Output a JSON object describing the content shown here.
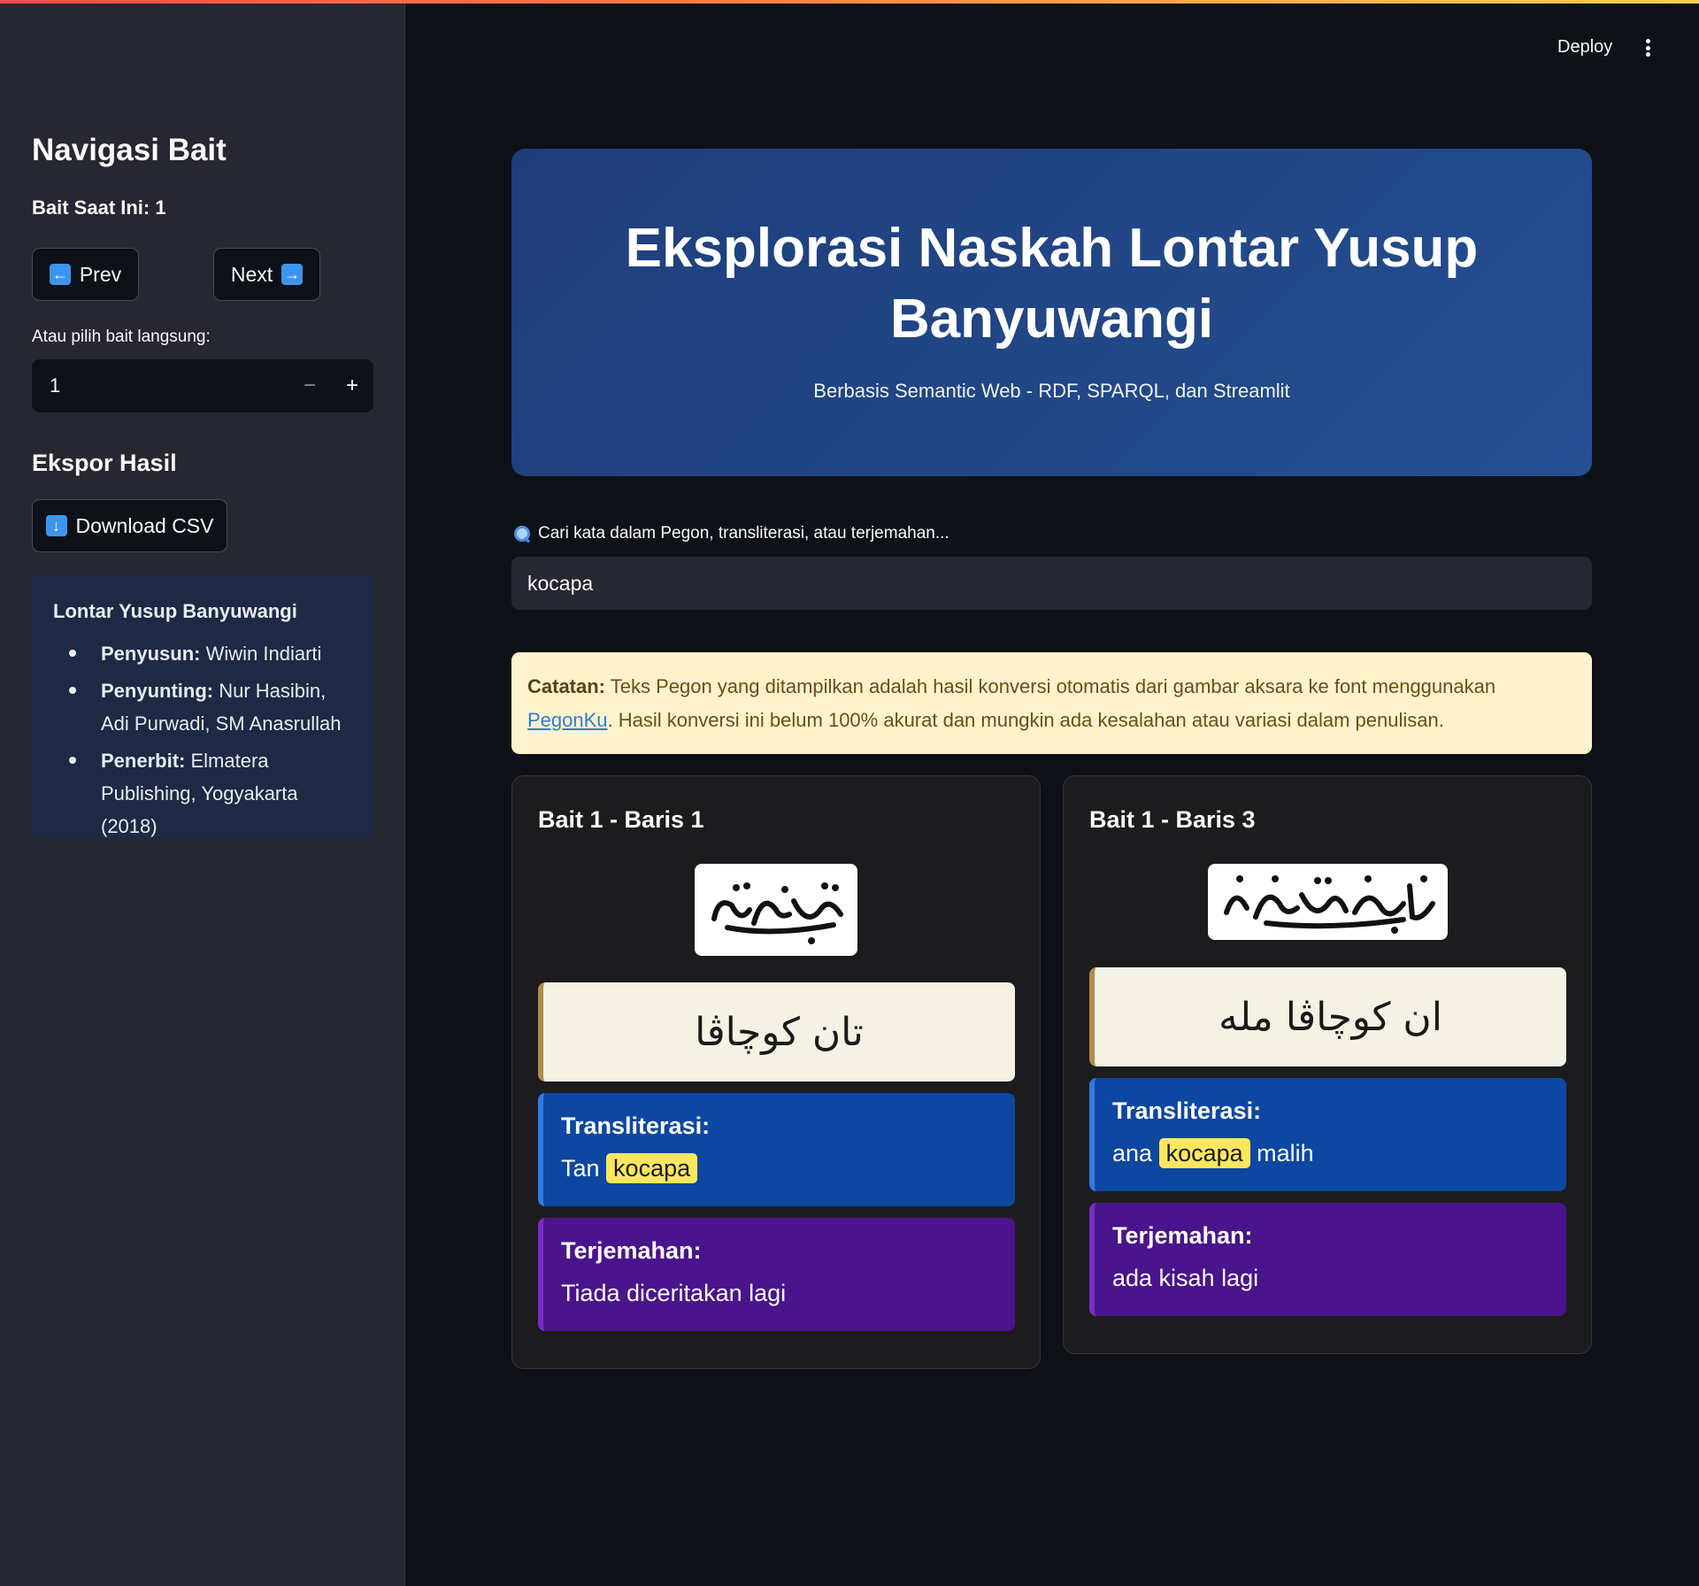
{
  "sidebar": {
    "title": "Navigasi Bait",
    "current": "Bait Saat Ini: 1",
    "prev_icon": "left-arrow-icon",
    "prev_label": "Prev",
    "next_label": "Next",
    "next_icon": "right-arrow-icon",
    "select_label": "Atau pilih bait langsung:",
    "stepper_value": "1",
    "stepper_minus": "−",
    "stepper_plus": "+",
    "export_title": "Ekspor Hasil",
    "download_icon": "down-arrow-icon",
    "download_label": "Download CSV",
    "info": {
      "title": "Lontar Yusup Banyuwangi",
      "items": [
        {
          "key": "Penyusun:",
          "value": "Wiwin Indiarti"
        },
        {
          "key": "Penyunting:",
          "value": "Nur Hasibin, Adi Purwadi, SM Anasrullah"
        },
        {
          "key": "Penerbit:",
          "value": "Elmatera Publishing, Yogyakarta (2018)"
        }
      ]
    }
  },
  "header": {
    "deploy": "Deploy",
    "menu_icon": "kebab-menu-icon"
  },
  "hero": {
    "title": "Eksplorasi Naskah Lontar Yusup Banyuwangi",
    "subtitle": "Berbasis Semantic Web - RDF, SPARQL, dan Streamlit"
  },
  "search": {
    "icon": "magnifier-icon",
    "label": "Cari kata dalam Pegon, transliterasi, atau terjemahan...",
    "value": "kocapa"
  },
  "note": {
    "bold": "Catatan:",
    "text_before": " Teks Pegon yang ditampilkan adalah hasil konversi otomatis dari gambar aksara ke font menggunakan ",
    "link": "PegonKu",
    "text_after": ". Hasil konversi ini belum 100% akurat dan mungkin ada kesalahan atau variasi dalam penulisan."
  },
  "cards": [
    {
      "title": "Bait 1 - Baris 1",
      "arabic": "تان كوچاڤا",
      "translit_label": "Transliterasi:",
      "translit_before": "Tan ",
      "translit_highlight": "kocapa",
      "translit_after": "",
      "terjemahan_label": "Terjemahan:",
      "terjemahan": "Tiada diceritakan lagi"
    },
    {
      "title": "Bait 1 - Baris 3",
      "arabic": "ان كوچاڤا مله",
      "translit_label": "Transliterasi:",
      "translit_before": "ana ",
      "translit_highlight": "kocapa",
      "translit_after": " malih",
      "terjemahan_label": "Terjemahan:",
      "terjemahan": "ada kisah lagi"
    }
  ]
}
